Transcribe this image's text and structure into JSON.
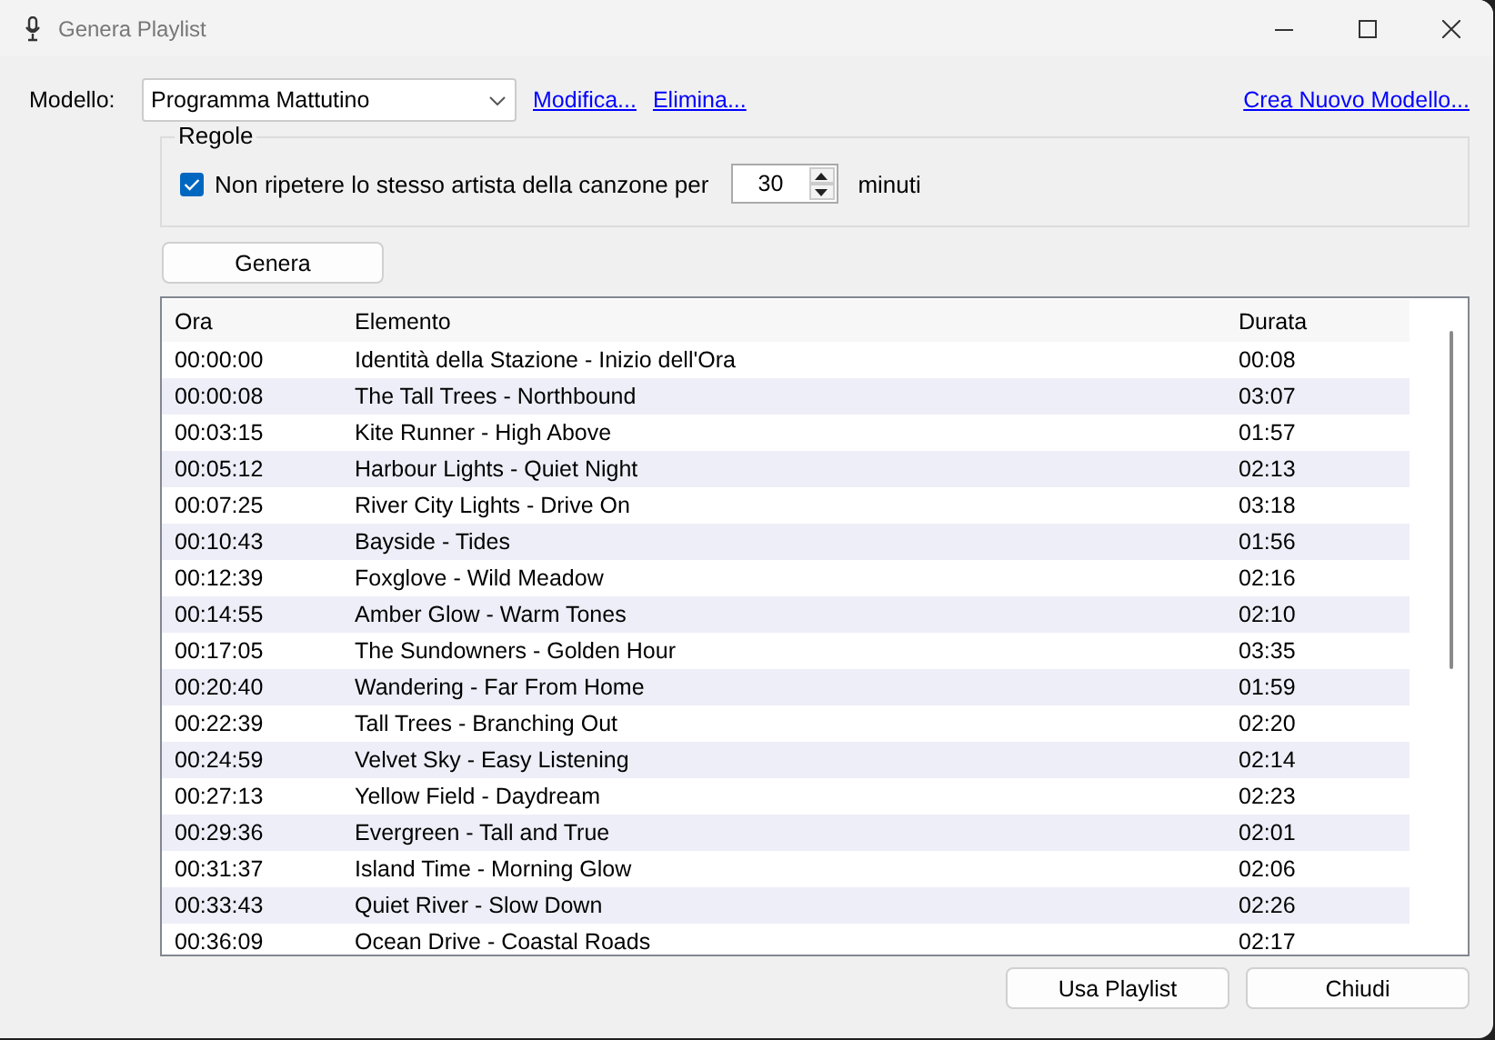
{
  "window": {
    "title": "Genera Playlist"
  },
  "template": {
    "label": "Modello:",
    "value": "Programma Mattutino",
    "links": [
      "Modifica...",
      "Elimina..."
    ],
    "new_link": "Crea Nuovo Modello..."
  },
  "rules": {
    "title": "Regole",
    "rule": {
      "label": "Non ripetere lo stesso artista della canzone per",
      "checked": true,
      "value": "30",
      "unit": "minuti"
    }
  },
  "generate_button": "Genera",
  "table": {
    "columns": [
      "Ora",
      "Elemento",
      "Durata"
    ],
    "rows": [
      [
        "00:00:00",
        "Identità della Stazione - Inizio dell'Ora",
        "00:08"
      ],
      [
        "00:00:08",
        "The Tall Trees - Northbound",
        "03:07"
      ],
      [
        "00:03:15",
        "Kite Runner - High Above",
        "01:57"
      ],
      [
        "00:05:12",
        "Harbour Lights - Quiet Night",
        "02:13"
      ],
      [
        "00:07:25",
        "River City Lights - Drive On",
        "03:18"
      ],
      [
        "00:10:43",
        "Bayside - Tides",
        "01:56"
      ],
      [
        "00:12:39",
        "Foxglove - Wild Meadow",
        "02:16"
      ],
      [
        "00:14:55",
        "Amber Glow - Warm Tones",
        "02:10"
      ],
      [
        "00:17:05",
        "The Sundowners - Golden Hour",
        "03:35"
      ],
      [
        "00:20:40",
        "Wandering - Far From Home",
        "01:59"
      ],
      [
        "00:22:39",
        "Tall Trees - Branching Out",
        "02:20"
      ],
      [
        "00:24:59",
        "Velvet Sky - Easy Listening",
        "02:14"
      ],
      [
        "00:27:13",
        "Yellow Field - Daydream",
        "02:23"
      ],
      [
        "00:29:36",
        "Evergreen - Tall and True",
        "02:01"
      ],
      [
        "00:31:37",
        "Island Time - Morning Glow",
        "02:06"
      ],
      [
        "00:33:43",
        "Quiet River - Slow Down",
        "02:26"
      ],
      [
        "00:36:09",
        "Ocean Drive - Coastal Roads",
        "02:17"
      ]
    ]
  },
  "buttons": [
    "Usa Playlist",
    "Chiudi"
  ]
}
